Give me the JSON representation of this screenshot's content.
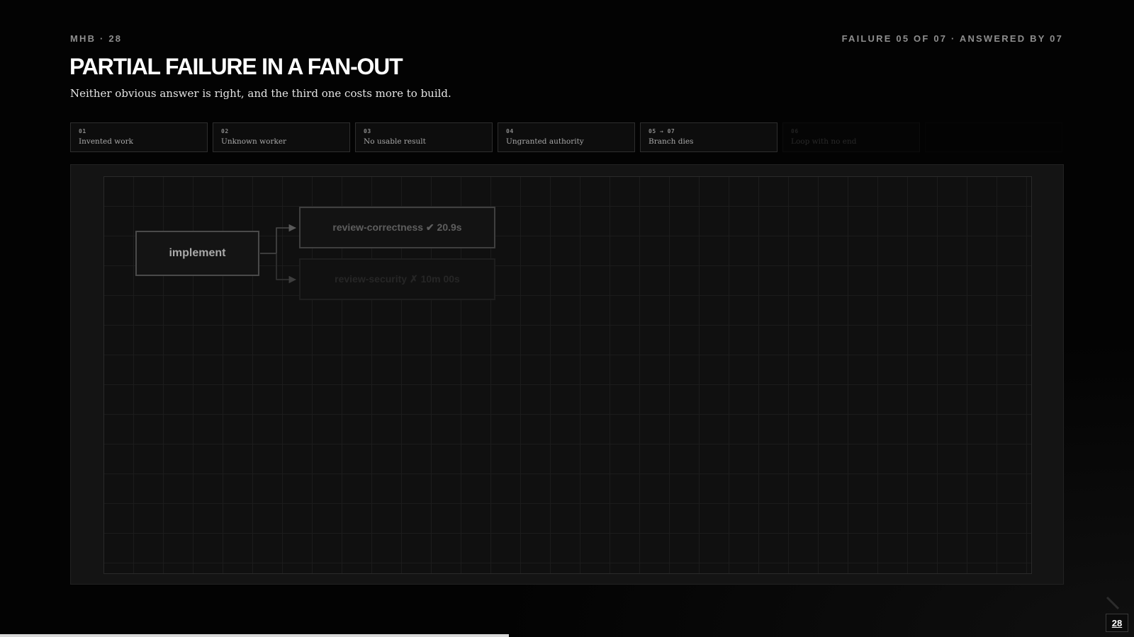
{
  "header": {
    "eyebrow_left": "MHB · 28",
    "eyebrow_right": "FAILURE 05 OF 07 · ANSWERED BY 07",
    "title": "PARTIAL FAILURE IN A FAN-OUT",
    "subtitle": "Neither obvious answer is right, and the third one costs more to build."
  },
  "steps": [
    {
      "num": "01",
      "label": "Invented work",
      "state": "visited"
    },
    {
      "num": "02",
      "label": "Unknown worker",
      "state": "visited"
    },
    {
      "num": "03",
      "label": "No usable result",
      "state": "visited"
    },
    {
      "num": "04",
      "label": "Ungranted authority",
      "state": "visited"
    },
    {
      "num": "05 → 07",
      "label": "Branch dies",
      "state": "current"
    },
    {
      "num": "06",
      "label": "Loop with no end",
      "state": "upcoming"
    },
    {
      "num": "",
      "label": "",
      "state": "hidden"
    }
  ],
  "diagram": {
    "source": {
      "label": "implement"
    },
    "branches": [
      {
        "label": "review-correctness ✔ 20.9s",
        "status": "success"
      },
      {
        "label": "review-security ✗ 10m 00s",
        "status": "failed"
      }
    ]
  },
  "footer": {
    "page_number": "28",
    "progress": 0.449
  },
  "colors": {
    "background": "#030303",
    "panel": "#141414",
    "text_primary": "#ffffff",
    "text_muted": "#8e8e8e"
  }
}
